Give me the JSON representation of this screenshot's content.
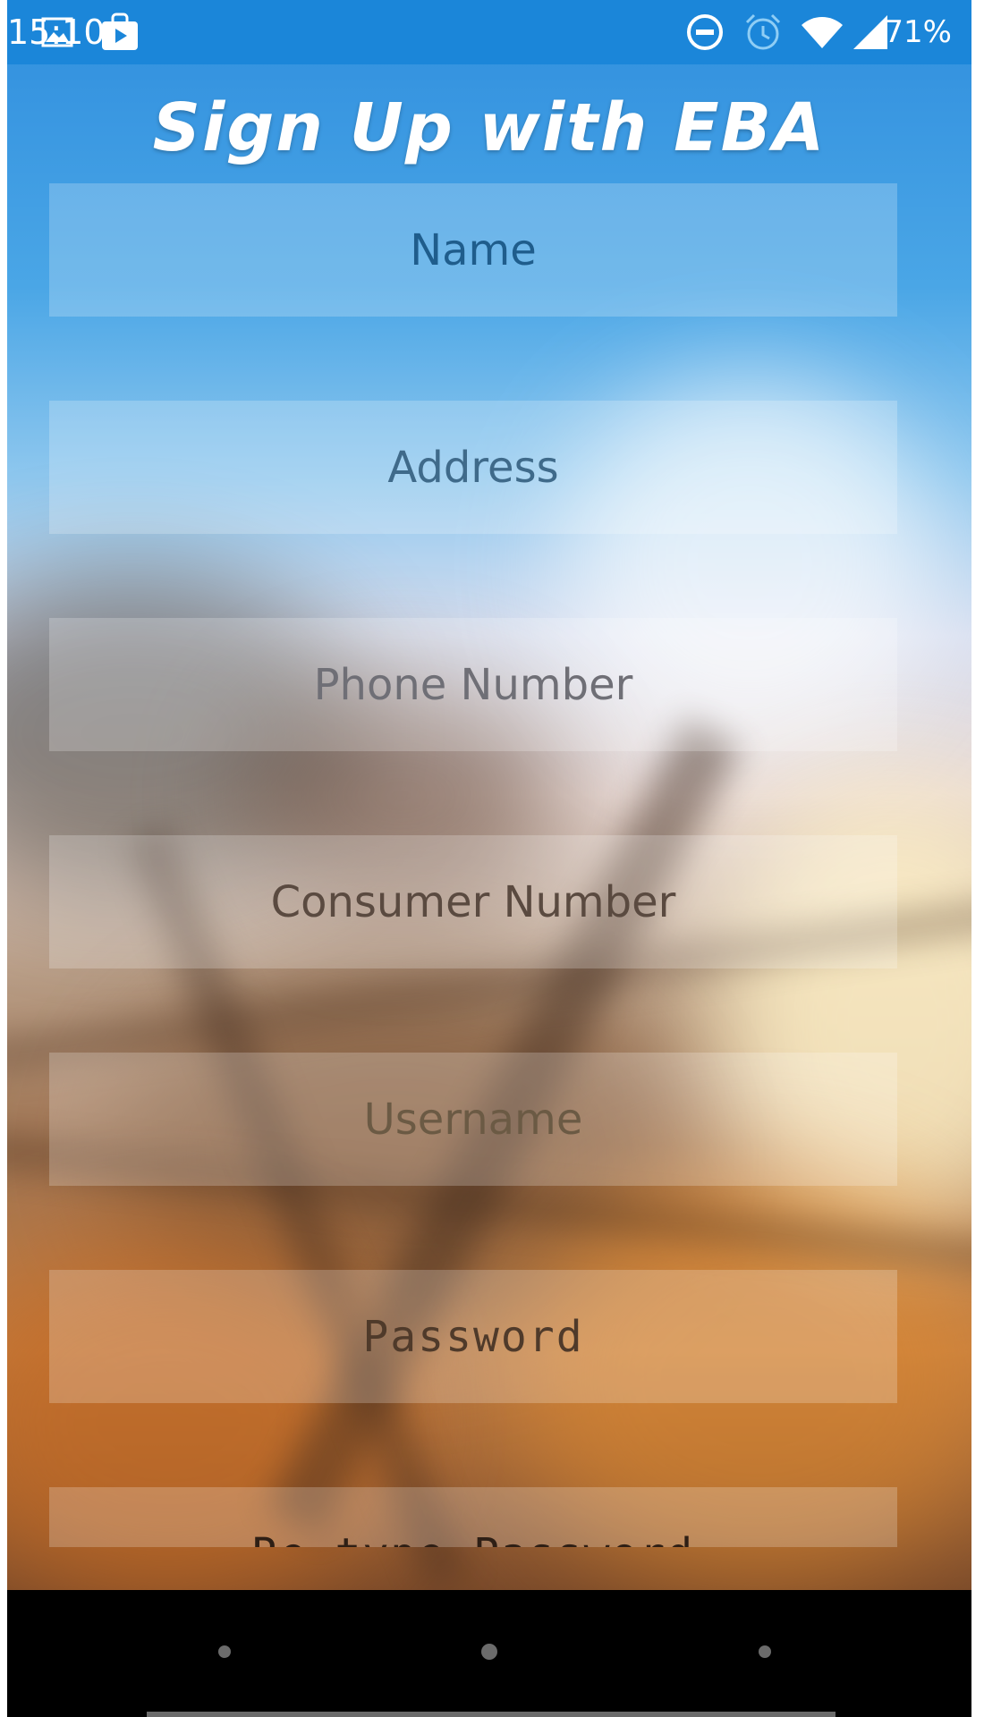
{
  "status_bar": {
    "time": "15:10",
    "battery_percent": "71%",
    "icons": [
      "gallery-icon",
      "play-store-icon",
      "dnd-icon",
      "alarm-icon",
      "wifi-icon",
      "signal-icon"
    ]
  },
  "header": {
    "title": "Sign Up with EBA"
  },
  "form": {
    "fields": [
      {
        "placeholder": "Name",
        "color": "#1f5d8c"
      },
      {
        "placeholder": "Address",
        "color": "#3f6a8a"
      },
      {
        "placeholder": "Phone Number",
        "color": "#6f6f76"
      },
      {
        "placeholder": "Consumer Number",
        "color": "#5a4a40"
      },
      {
        "placeholder": "Username",
        "color": "#6b5a44"
      },
      {
        "placeholder": "Password",
        "color": "#4f3a2a"
      },
      {
        "placeholder": "Re-type Password",
        "color": "#2e1f15"
      }
    ]
  },
  "navigation": {
    "buttons": [
      "back-button",
      "home-button",
      "recents-button"
    ]
  },
  "colors": {
    "status_bar": "#1b86d9",
    "nav_bar": "#000000"
  }
}
